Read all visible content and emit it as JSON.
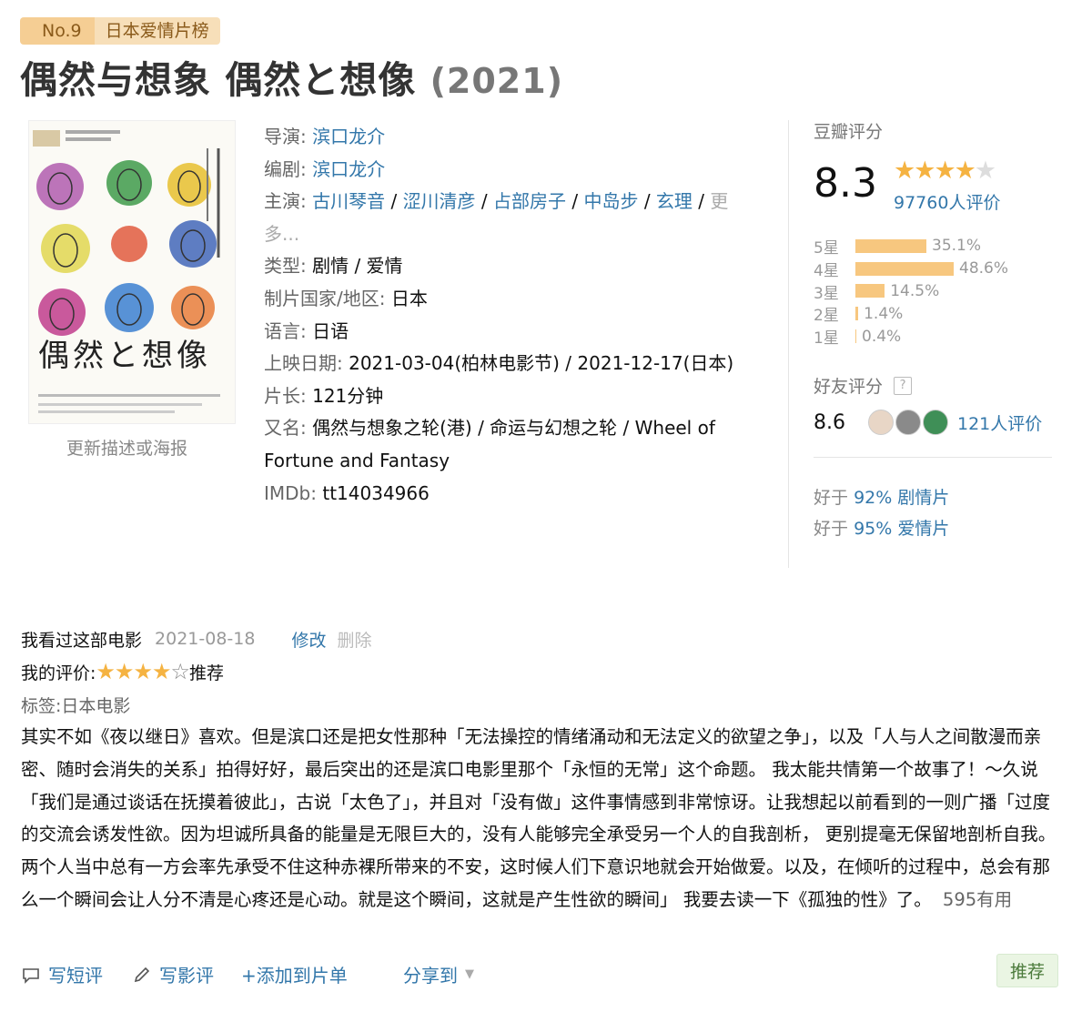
{
  "rank": {
    "no": "No.9",
    "list": "日本爱情片榜"
  },
  "title": {
    "main": "偶然与想象 偶然と想像",
    "year": "(2021)"
  },
  "poster": {
    "title": "偶然と想像",
    "update_link": "更新描述或海报"
  },
  "info": {
    "director_label": "导演:",
    "director": "滨口龙介",
    "writer_label": "编剧:",
    "writer": "滨口龙介",
    "cast_label": "主演:",
    "cast": [
      "古川琴音",
      "涩川清彦",
      "占部房子",
      "中岛步",
      "玄理"
    ],
    "cast_more": "更多...",
    "genre_label": "类型:",
    "genre": "剧情 / 爱情",
    "country_label": "制片国家/地区:",
    "country": "日本",
    "language_label": "语言:",
    "language": "日语",
    "release_label": "上映日期:",
    "release": "2021-03-04(柏林电影节) / 2021-12-17(日本)",
    "runtime_label": "片长:",
    "runtime": "121分钟",
    "aka_label": "又名:",
    "aka": "偶然与想象之轮(港) / 命运与幻想之轮 / Wheel of Fortune and Fantasy",
    "imdb_label": "IMDb:",
    "imdb": "tt14034966"
  },
  "rating": {
    "title": "豆瓣评分",
    "score": "8.3",
    "stars_value": 4,
    "count": "97760人评价",
    "distribution": [
      {
        "label": "5星",
        "percent": 35.1,
        "text": "35.1%"
      },
      {
        "label": "4星",
        "percent": 48.6,
        "text": "48.6%"
      },
      {
        "label": "3星",
        "percent": 14.5,
        "text": "14.5%"
      },
      {
        "label": "2星",
        "percent": 1.4,
        "text": "1.4%"
      },
      {
        "label": "1星",
        "percent": 0.4,
        "text": "0.4%"
      }
    ],
    "friend_title": "好友评分",
    "friend_help": "?",
    "friend_score": "8.6",
    "friend_count": "121人评价",
    "better_prefix": "好于",
    "better": [
      {
        "percent": "92%",
        "genre": "剧情片"
      },
      {
        "percent": "95%",
        "genre": "爱情片"
      }
    ]
  },
  "review": {
    "watched": "我看过这部电影",
    "date": "2021-08-18",
    "edit": "修改",
    "delete": "删除",
    "my_rating_label": "我的评价:",
    "my_stars": 4,
    "my_rating_word": "推荐",
    "tags": "标签:日本电影",
    "text": "其实不如《夜以继日》喜欢。但是滨口还是把女性那种「无法操控的情绪涌动和无法定义的欲望之争」，以及「人与人之间散漫而亲密、随时会消失的关系」拍得好好，最后突出的还是滨口电影里那个「永恒的无常」这个命题。 我太能共情第一个故事了！～久说「我们是通过谈话在抚摸着彼此」，古说「太色了」，并且对「没有做」这件事情感到非常惊讶。让我想起以前看到的一则广播「过度的交流会诱发性欲。因为坦诚所具备的能量是无限巨大的，没有人能够完全承受另一个人的自我剖析， 更别提毫无保留地剖析自我。两个人当中总有一方会率先承受不住这种赤裸所带来的不安，这时候人们下意识地就会开始做爱。以及，在倾听的过程中，总会有那么一个瞬间会让人分不清是心疼还是心动。就是这个瞬间，这就是产生性欲的瞬间」 我要去读一下《孤独的性》了。",
    "useful": "595有用"
  },
  "actions": {
    "short_review": "写短评",
    "long_review": "写影评",
    "add_list": "+添加到片单",
    "share": "分享到",
    "recommend": "推荐"
  }
}
